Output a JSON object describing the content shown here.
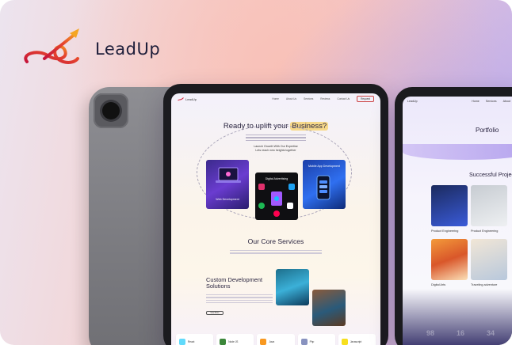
{
  "brand": {
    "name": "LeadUp",
    "icon": "leadup-arrow-logo"
  },
  "main_screen": {
    "nav": {
      "logo": "LeadUp",
      "links": [
        "Home",
        "About Us",
        "Services",
        "Reviews",
        "Contact Us"
      ],
      "cta": "Request"
    },
    "hero": {
      "title_prefix": "Ready to uplift your ",
      "title_highlight": "Business?",
      "subtitle_line1": "Launch Growth With Our Expertise",
      "subtitle_line2": "Lets reach new heights together"
    },
    "cards": [
      {
        "label": "Web Development",
        "icon": "laptop-icon"
      },
      {
        "label": "Digital Advertising",
        "icon": "social-apps-icon"
      },
      {
        "label": "Mobile App Development",
        "icon": "phone-icon"
      }
    ],
    "services": {
      "title": "Our Core Services"
    },
    "custom_dev": {
      "title": "Custom Development Solutions",
      "button": "View More"
    },
    "tech": [
      {
        "label": "React",
        "color": "#61dafb"
      },
      {
        "label": "Node JS",
        "color": "#3c873a"
      },
      {
        "label": "Java",
        "color": "#f89820"
      },
      {
        "label": "Php",
        "color": "#8892bf"
      },
      {
        "label": "Javascript",
        "color": "#f7df1e"
      }
    ]
  },
  "right_screen": {
    "nav": {
      "logo": "LeadUp",
      "links": [
        "Home",
        "Services",
        "About"
      ]
    },
    "title": "Portfolio",
    "section_title": "Successful Projects",
    "projects": [
      {
        "caption": "Product Engineering"
      },
      {
        "caption": "Product Engineering"
      },
      {
        "caption": "Digital Arts"
      },
      {
        "caption": "Traveling adventure"
      }
    ],
    "stats": [
      "98",
      "16",
      "34"
    ]
  },
  "colors": {
    "accent": "#f7d98a",
    "brand_orange": "#f28c28",
    "brand_red": "#d7263d"
  }
}
